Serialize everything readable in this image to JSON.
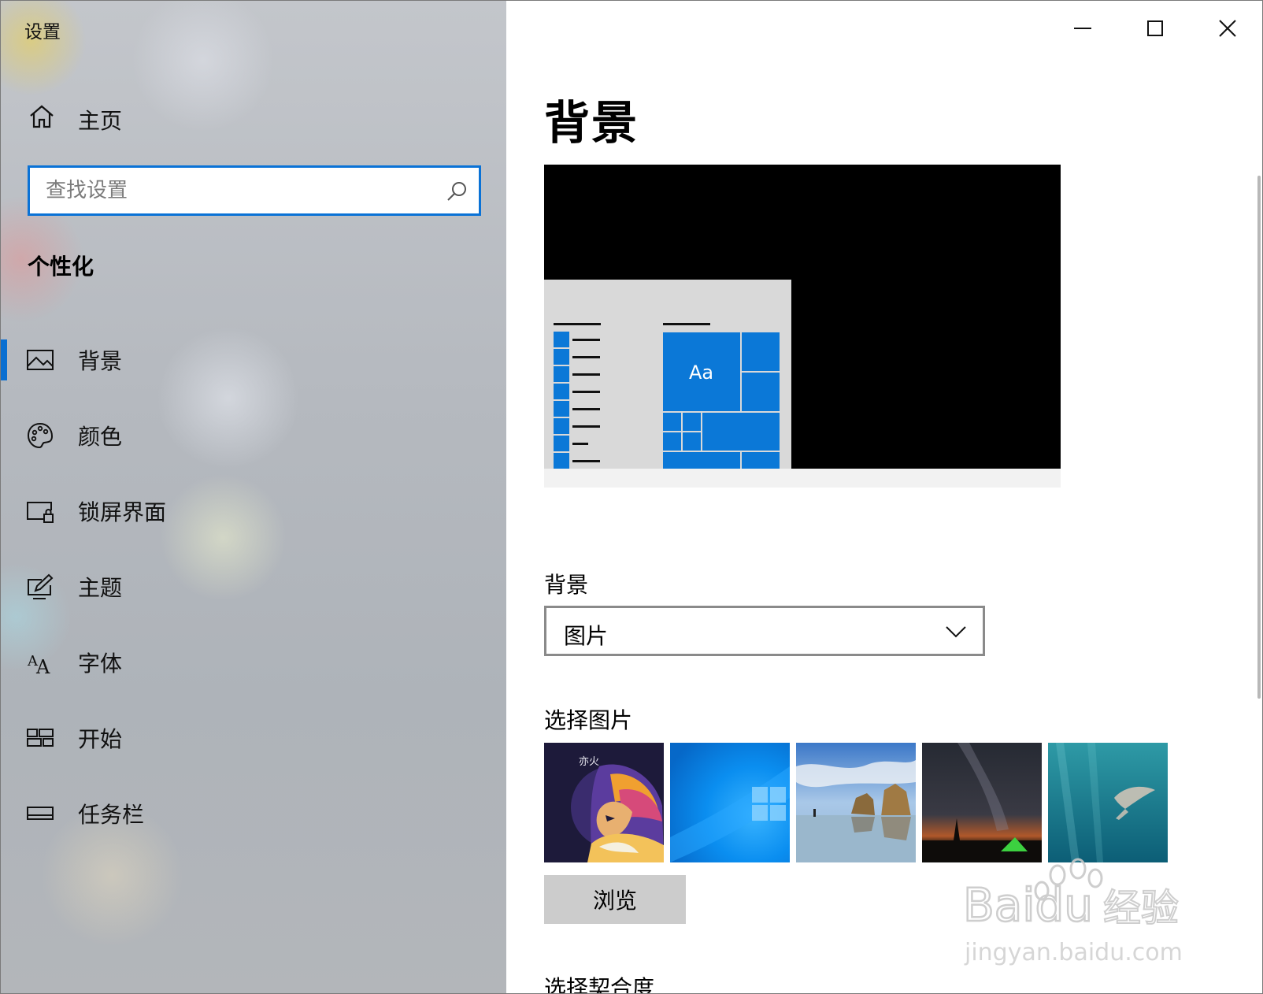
{
  "window": {
    "title": "设置",
    "controls": {
      "minimize": "minimize",
      "maximize": "maximize",
      "close": "close"
    }
  },
  "nav": {
    "home_label": "主页",
    "search_placeholder": "查找设置",
    "section_title": "个性化",
    "items": [
      {
        "label": "背景",
        "icon": "picture-icon",
        "selected": true
      },
      {
        "label": "颜色",
        "icon": "palette-icon",
        "selected": false
      },
      {
        "label": "锁屏界面",
        "icon": "lock-screen-icon",
        "selected": false
      },
      {
        "label": "主题",
        "icon": "theme-icon",
        "selected": false
      },
      {
        "label": "字体",
        "icon": "font-icon",
        "selected": false
      },
      {
        "label": "开始",
        "icon": "start-icon",
        "selected": false
      },
      {
        "label": "任务栏",
        "icon": "taskbar-icon",
        "selected": false
      }
    ]
  },
  "main": {
    "page_title": "背景",
    "preview": {
      "tile_text": "Aa",
      "accent_color": "#0b78d7",
      "desktop_color": "#000000"
    },
    "background_label": "背景",
    "background_select": {
      "value": "图片"
    },
    "choose_picture_label": "选择图片",
    "pictures": [
      {
        "icon": "wallpaper-art-portrait-thumbnail",
        "text": "亦火"
      },
      {
        "icon": "wallpaper-windows-blue-thumbnail"
      },
      {
        "icon": "wallpaper-beach-rocks-thumbnail"
      },
      {
        "icon": "wallpaper-night-sky-tent-thumbnail"
      },
      {
        "icon": "wallpaper-underwater-swimmer-thumbnail"
      }
    ],
    "browse_label": "浏览",
    "choose_fit_label": "选择契合度"
  },
  "watermark": {
    "brand": "Baidu",
    "product": "经验",
    "url": "jingyan.baidu.com"
  }
}
